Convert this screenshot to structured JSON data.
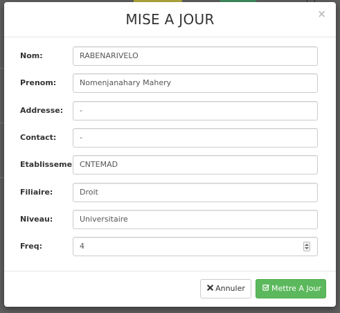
{
  "modal": {
    "title": "MISE A JOUR",
    "close_symbol": "×"
  },
  "form": {
    "fields": [
      {
        "label": "Nom:",
        "value": "RABENARIVELO"
      },
      {
        "label": "Prenom:",
        "value": "Nomenjanahary Mahery"
      },
      {
        "label": "Addresse:",
        "value": "-"
      },
      {
        "label": "Contact:",
        "value": "-"
      },
      {
        "label": "Etablissement:",
        "value": "CNTEMAD"
      },
      {
        "label": "Filiaire:",
        "value": "Droit"
      },
      {
        "label": "Niveau:",
        "value": "Universitaire"
      },
      {
        "label": "Freq:",
        "value": "4"
      }
    ]
  },
  "footer": {
    "cancel_label": "Annuler",
    "cancel_icon": "times-icon",
    "save_label": "Mettre A Jour",
    "save_icon": "check-square-icon"
  },
  "colors": {
    "save_green": "#5cb85c",
    "overlay": "#5f5f5f"
  }
}
